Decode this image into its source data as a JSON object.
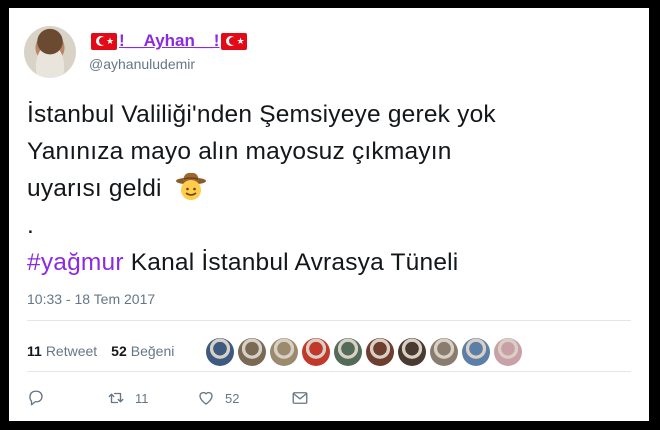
{
  "tweet": {
    "display_name": "!__Ayhan__!",
    "handle": "@ayhanuludemir",
    "text_lines": [
      "İstanbul Valiliği'nden  Şemsiyeye gerek yok",
      "Yanınıza mayo alın mayosuz çıkmayın",
      "uyarısı geldi",
      "."
    ],
    "hashtag": "#yağmur",
    "hashtag_rest": " Kanal İstanbul Avrasya Tüneli",
    "emoji": "cowboy-face-emoji",
    "timestamp": "10:33 - 18 Tem 2017"
  },
  "stats": {
    "retweets_count": "11",
    "retweets_label": "Retweet",
    "likes_count": "52",
    "likes_label": "Beğeni"
  },
  "likers": [
    "#3d5a80",
    "#7a6a55",
    "#9b8a6e",
    "#c0392b",
    "#556b5a",
    "#6e3f2e",
    "#4a3b30",
    "#8a7d70",
    "#5b7fa6",
    "#c9a0a8"
  ],
  "actions": {
    "reply_icon": "reply-icon",
    "retweet_count": "11",
    "like_count": "52",
    "dm_icon": "envelope-icon"
  },
  "colors": {
    "accent": "#8a2be2",
    "muted": "#657786",
    "flag_red": "#e30a17"
  }
}
